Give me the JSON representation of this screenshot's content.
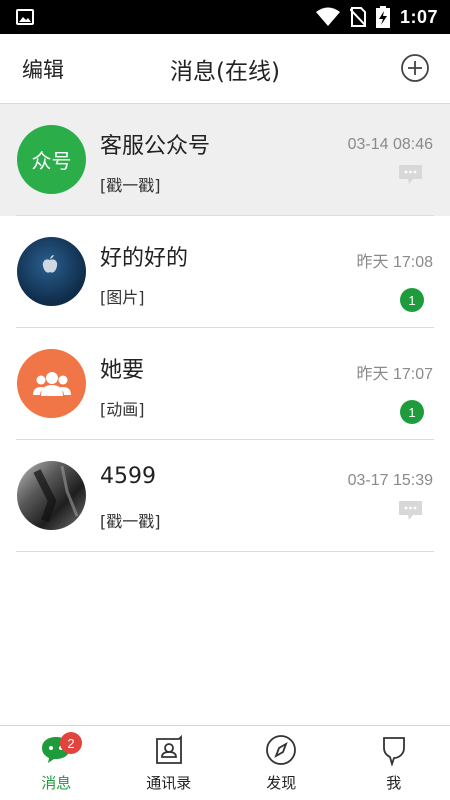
{
  "status_bar": {
    "time": "1:07",
    "icons": [
      "image-icon",
      "wifi-icon",
      "no-sim-icon",
      "battery-charging-icon"
    ]
  },
  "header": {
    "edit_label": "编辑",
    "title": "消息(在线)",
    "add_icon": "add-circle-icon"
  },
  "conversations": [
    {
      "name": "客服公众号",
      "preview": "[戳一戳]",
      "time": "03-14 08:46",
      "avatar_text": "众号",
      "avatar_color": "#2bad4a",
      "indicator": "message-bubble-icon",
      "pinned": true
    },
    {
      "name": "好的好的",
      "preview": "[图片]",
      "time": "昨天 17:08",
      "unread": "1",
      "avatar_color": "#173a5e",
      "avatar_icon": "apple-logo-icon"
    },
    {
      "name": "她要",
      "preview": "[动画]",
      "time": "昨天 17:07",
      "unread": "1",
      "avatar_color": "#f07547",
      "avatar_icon": "group-icon"
    },
    {
      "name": "4599",
      "preview": "[戳一戳]",
      "time": "03-17 15:39",
      "avatar_color": "#3a3a3a",
      "avatar_icon": "photo-avatar",
      "indicator": "message-bubble-icon"
    }
  ],
  "tabbar": {
    "tabs": [
      {
        "label": "消息",
        "icon": "chat-icon",
        "active": true,
        "badge": "2"
      },
      {
        "label": "通讯录",
        "icon": "contacts-icon"
      },
      {
        "label": "发现",
        "icon": "compass-icon"
      },
      {
        "label": "我",
        "icon": "profile-icon"
      }
    ]
  },
  "colors": {
    "accent": "#1e9c3c",
    "badge_red": "#e2433d",
    "pinned_bg": "#efefef"
  }
}
